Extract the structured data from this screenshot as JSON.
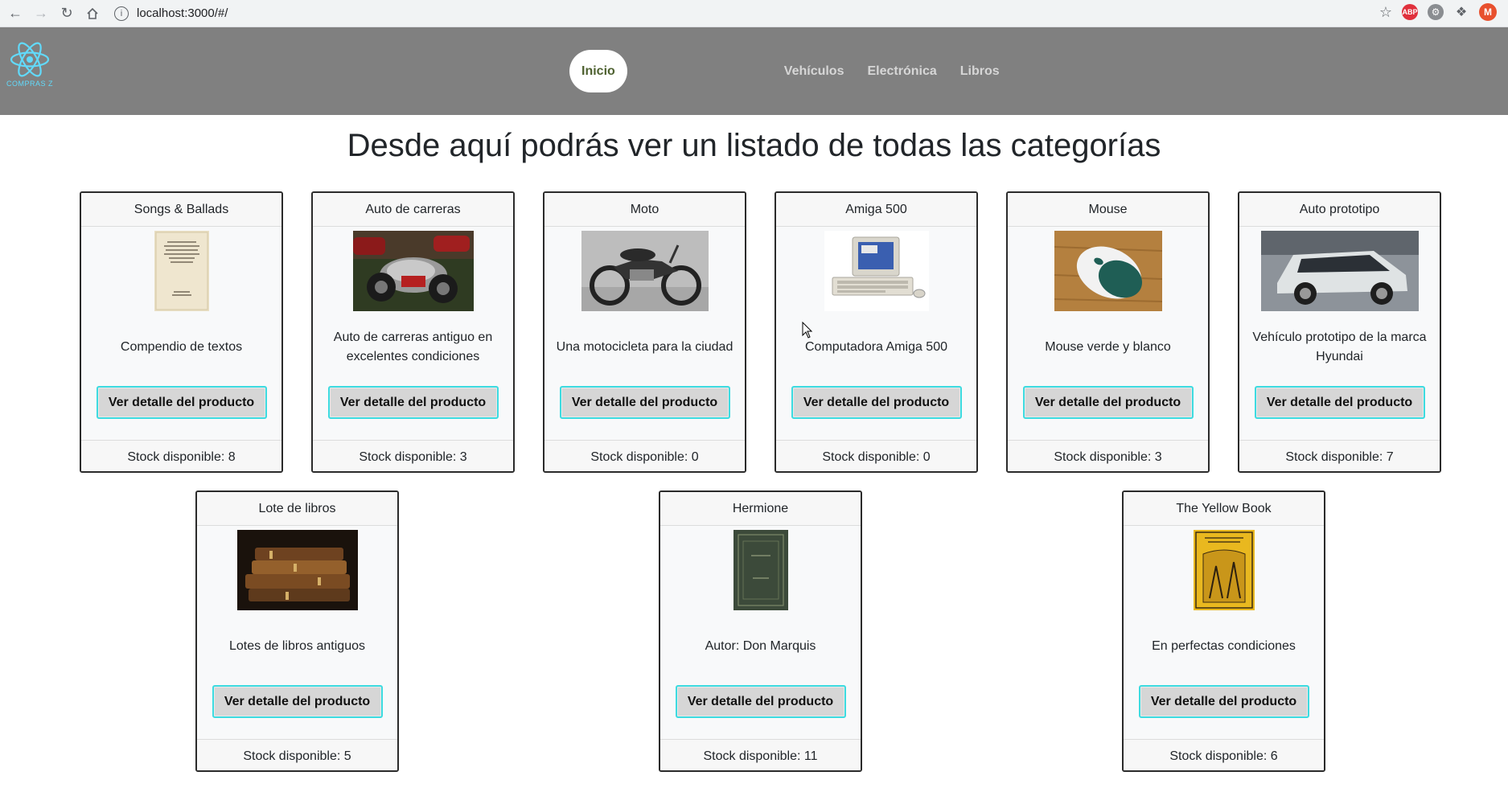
{
  "browser": {
    "url": "localhost:3000/#/",
    "info_glyph": "i"
  },
  "header": {
    "logo_text": "COMPRAS Z",
    "nav": {
      "active": "Inicio",
      "links": [
        "Vehículos",
        "Electrónica",
        "Libros"
      ]
    }
  },
  "page": {
    "title": "Desde aquí podrás ver un listado de todas las categorías",
    "button_label": "Ver detalle del producto"
  },
  "products": [
    {
      "name": "Songs & Ballads",
      "description": "Compendio de textos",
      "stock": "Stock disponible: 8",
      "image": "book-cover-icon"
    },
    {
      "name": "Auto de carreras",
      "description": "Auto de carreras antiguo en excelentes condiciones",
      "stock": "Stock disponible: 3",
      "image": "race-car-icon"
    },
    {
      "name": "Moto",
      "description": "Una motocicleta para la ciudad",
      "stock": "Stock disponible: 0",
      "image": "motorcycle-icon"
    },
    {
      "name": "Amiga 500",
      "description": "Computadora Amiga 500",
      "stock": "Stock disponible: 0",
      "image": "computer-icon"
    },
    {
      "name": "Mouse",
      "description": "Mouse verde y blanco",
      "stock": "Stock disponible: 3",
      "image": "mouse-icon"
    },
    {
      "name": "Auto prototipo",
      "description": "Vehículo prototipo de la marca Hyundai",
      "stock": "Stock disponible: 7",
      "image": "concept-car-icon"
    },
    {
      "name": "Lote de libros",
      "description": "Lotes de libros antiguos",
      "stock": "Stock disponible: 5",
      "image": "books-stack-icon"
    },
    {
      "name": "Hermione",
      "description": "Autor: Don Marquis",
      "stock": "Stock disponible: 11",
      "image": "green-book-icon"
    },
    {
      "name": "The Yellow Book",
      "description": "En perfectas condiciones",
      "stock": "Stock disponible: 6",
      "image": "yellow-book-icon"
    }
  ],
  "colors": {
    "header_bg": "#808080",
    "button_border": "#3ddbe0",
    "button_bg": "#d6d6d6"
  }
}
